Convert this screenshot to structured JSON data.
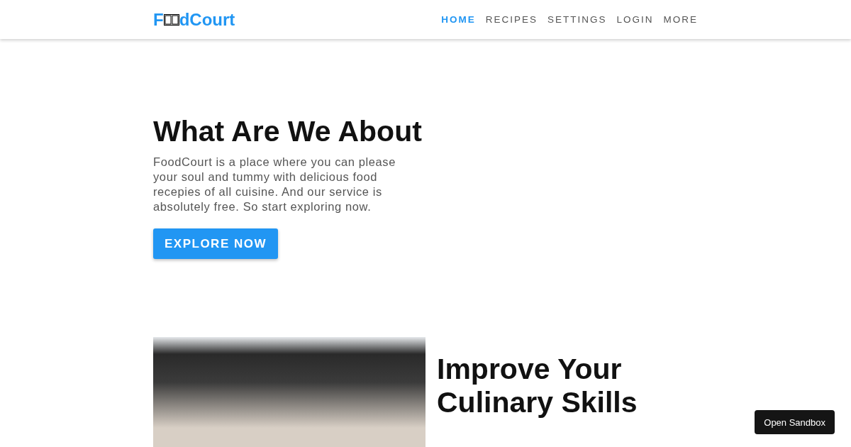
{
  "logo": {
    "before": "F",
    "after": "dCourt"
  },
  "nav": [
    {
      "label": "HOME",
      "selected": true
    },
    {
      "label": "RECIPES",
      "selected": false
    },
    {
      "label": "SETTINGS",
      "selected": false
    },
    {
      "label": "LOGIN",
      "selected": false
    },
    {
      "label": "MORE",
      "selected": false
    }
  ],
  "about": {
    "title": "What Are We About",
    "text": "FoodCourt is a place where you can please your soul and tummy with delicious food recepies of all cuisine. And our service is absolutely free. So start exploring now.",
    "button": "EXPLORE NOW"
  },
  "skills": {
    "title": "Improve Your Culinary Skills"
  },
  "sandbox_button": "Open Sandbox"
}
